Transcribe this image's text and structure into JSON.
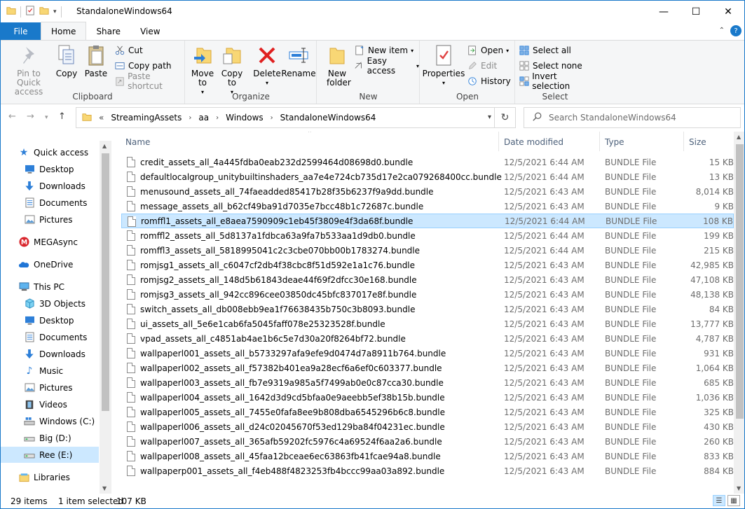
{
  "window": {
    "title": "StandaloneWindows64",
    "accent": "#1979ca",
    "controls": {
      "minimize": "—",
      "maximize": "☐",
      "close": "✕"
    }
  },
  "ribbon_tabs": [
    "File",
    "Home",
    "Share",
    "View"
  ],
  "help": "?",
  "ribbon": {
    "clipboard": {
      "label": "Clipboard",
      "pin": "Pin to Quick access",
      "copy": "Copy",
      "paste": "Paste",
      "cut": "Cut",
      "copy_path": "Copy path",
      "paste_shortcut": "Paste shortcut"
    },
    "organize": {
      "label": "Organize",
      "move_to": "Move to",
      "copy_to": "Copy to",
      "delete": "Delete",
      "rename": "Rename"
    },
    "new": {
      "label": "New",
      "new_folder": "New folder",
      "new_item": "New item",
      "easy_access": "Easy access"
    },
    "open": {
      "label": "Open",
      "properties": "Properties",
      "open": "Open",
      "edit": "Edit",
      "history": "History"
    },
    "select": {
      "label": "Select",
      "select_all": "Select all",
      "select_none": "Select none",
      "invert": "Invert selection"
    }
  },
  "address": {
    "prefix": "«",
    "crumbs": [
      "StreamingAssets",
      "aa",
      "Windows",
      "StandaloneWindows64"
    ],
    "search_placeholder": "Search StandaloneWindows64"
  },
  "nav": {
    "quick_access": "Quick access",
    "quick_items": [
      "Desktop",
      "Downloads",
      "Documents",
      "Pictures"
    ],
    "mega": "MEGAsync",
    "onedrive": "OneDrive",
    "this_pc": "This PC",
    "pc_items": [
      "3D Objects",
      "Desktop",
      "Documents",
      "Downloads",
      "Music",
      "Pictures",
      "Videos",
      "Windows (C:)",
      "Big (D:)",
      "Ree (E:)"
    ],
    "libraries": "Libraries",
    "selected": "Ree (E:)"
  },
  "columns": {
    "name": "Name",
    "date": "Date modified",
    "type": "Type",
    "size": "Size"
  },
  "files": [
    {
      "name": "credit_assets_all_4a445fdba0eab232d2599464d08698d0.bundle",
      "date": "12/5/2021 6:44 AM",
      "type": "BUNDLE File",
      "size": "15 KB"
    },
    {
      "name": "defaultlocalgroup_unitybuiltinshaders_aa7e4e724cb735d17e2ca079268400cc.bundle",
      "date": "12/5/2021 6:44 AM",
      "type": "BUNDLE File",
      "size": "13 KB"
    },
    {
      "name": "menusound_assets_all_74faeadded85417b28f35b6237f9a9dd.bundle",
      "date": "12/5/2021 6:43 AM",
      "type": "BUNDLE File",
      "size": "8,014 KB"
    },
    {
      "name": "message_assets_all_b62cf49ba91d7035e7bcc48b1c72687c.bundle",
      "date": "12/5/2021 6:43 AM",
      "type": "BUNDLE File",
      "size": "9 KB"
    },
    {
      "name": "romffl1_assets_all_e8aea7590909c1eb45f3809e4f3da68f.bundle",
      "date": "12/5/2021 6:44 AM",
      "type": "BUNDLE File",
      "size": "108 KB"
    },
    {
      "name": "romffl2_assets_all_5d8137a1fdbca63a9fa7b533aa1d9db0.bundle",
      "date": "12/5/2021 6:44 AM",
      "type": "BUNDLE File",
      "size": "199 KB"
    },
    {
      "name": "romffl3_assets_all_5818995041c2c3cbe070bb00b1783274.bundle",
      "date": "12/5/2021 6:44 AM",
      "type": "BUNDLE File",
      "size": "215 KB"
    },
    {
      "name": "romjsg1_assets_all_c6047cf2db4f38cbc8f51d592e1a1c76.bundle",
      "date": "12/5/2021 6:43 AM",
      "type": "BUNDLE File",
      "size": "42,985 KB"
    },
    {
      "name": "romjsg2_assets_all_148d5b61843deae44f69f2dfcc30e168.bundle",
      "date": "12/5/2021 6:43 AM",
      "type": "BUNDLE File",
      "size": "47,108 KB"
    },
    {
      "name": "romjsg3_assets_all_942cc896cee03850dc45bfc837017e8f.bundle",
      "date": "12/5/2021 6:43 AM",
      "type": "BUNDLE File",
      "size": "48,138 KB"
    },
    {
      "name": "switch_assets_all_db008ebb9ea1f76638435b750c3b8093.bundle",
      "date": "12/5/2021 6:43 AM",
      "type": "BUNDLE File",
      "size": "84 KB"
    },
    {
      "name": "ui_assets_all_5e6e1cab6fa5045faff078e25323528f.bundle",
      "date": "12/5/2021 6:43 AM",
      "type": "BUNDLE File",
      "size": "13,777 KB"
    },
    {
      "name": "vpad_assets_all_c4851ab4ae1b6c5e7d30a20f8264bf72.bundle",
      "date": "12/5/2021 6:43 AM",
      "type": "BUNDLE File",
      "size": "4,787 KB"
    },
    {
      "name": "wallpaperl001_assets_all_b5733297afa9efe9d0474d7a8911b764.bundle",
      "date": "12/5/2021 6:43 AM",
      "type": "BUNDLE File",
      "size": "931 KB"
    },
    {
      "name": "wallpaperl002_assets_all_f57382b401ea9a28ecf6a6ef0c603377.bundle",
      "date": "12/5/2021 6:43 AM",
      "type": "BUNDLE File",
      "size": "1,064 KB"
    },
    {
      "name": "wallpaperl003_assets_all_fb7e9319a985a5f7499ab0e0c87cca30.bundle",
      "date": "12/5/2021 6:43 AM",
      "type": "BUNDLE File",
      "size": "685 KB"
    },
    {
      "name": "wallpaperl004_assets_all_1642d3d9cd5bfaa0e9aeebb5ef38b15b.bundle",
      "date": "12/5/2021 6:43 AM",
      "type": "BUNDLE File",
      "size": "1,036 KB"
    },
    {
      "name": "wallpaperl005_assets_all_7455e0fafa8ee9b808dba6545296b6c8.bundle",
      "date": "12/5/2021 6:43 AM",
      "type": "BUNDLE File",
      "size": "325 KB"
    },
    {
      "name": "wallpaperl006_assets_all_d24c02045670f53ed129ba84f04231ec.bundle",
      "date": "12/5/2021 6:43 AM",
      "type": "BUNDLE File",
      "size": "430 KB"
    },
    {
      "name": "wallpaperl007_assets_all_365afb59202fc5976c4a69524f6aa2a6.bundle",
      "date": "12/5/2021 6:43 AM",
      "type": "BUNDLE File",
      "size": "260 KB"
    },
    {
      "name": "wallpaperl008_assets_all_45faa12bceae6ec63863fb41fcae94a8.bundle",
      "date": "12/5/2021 6:43 AM",
      "type": "BUNDLE File",
      "size": "833 KB"
    },
    {
      "name": "wallpaperp001_assets_all_f4eb488f4823253fb4bccc99aa03a892.bundle",
      "date": "12/5/2021 6:43 AM",
      "type": "BUNDLE File",
      "size": "884 KB"
    }
  ],
  "selected_file_index": 4,
  "status": {
    "items": "29 items",
    "selected": "1 item selected",
    "size": "107 KB"
  }
}
